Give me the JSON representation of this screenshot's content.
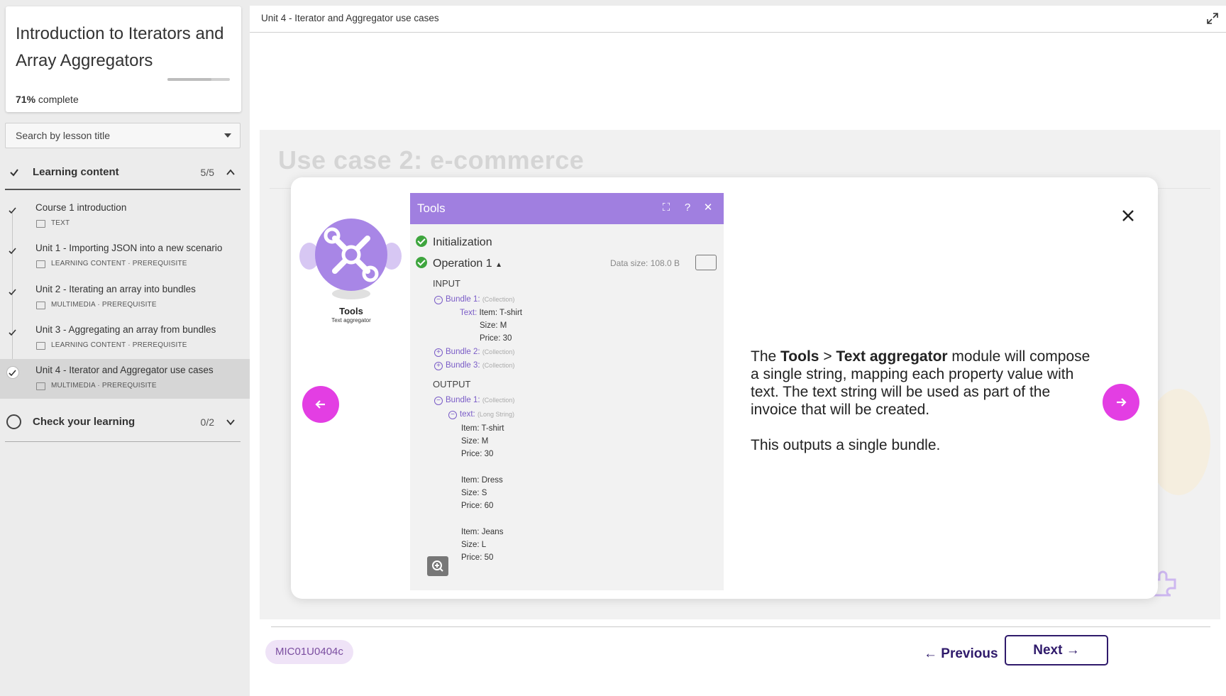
{
  "course": {
    "title": "Introduction to Iterators and Array Aggregators",
    "progress_percent": 71,
    "progress_value": "71%",
    "progress_suffix": "complete"
  },
  "search": {
    "placeholder": "Search by lesson title"
  },
  "sections": [
    {
      "title": "Learning content",
      "count": "5/5",
      "expanded": true,
      "lessons": [
        {
          "title": "Course 1 introduction",
          "meta": "TEXT",
          "completed": true,
          "active": false
        },
        {
          "title": "Unit 1 - Importing JSON into a new scenario",
          "meta": "LEARNING CONTENT · PREREQUISITE",
          "completed": true,
          "active": false
        },
        {
          "title": "Unit 2 - Iterating an array into bundles",
          "meta": "MULTIMEDIA · PREREQUISITE",
          "completed": true,
          "active": false
        },
        {
          "title": "Unit 3 - Aggregating an array from bundles",
          "meta": "LEARNING CONTENT · PREREQUISITE",
          "completed": true,
          "active": false
        },
        {
          "title": "Unit 4 - Iterator and Aggregator use cases",
          "meta": "MULTIMEDIA · PREREQUISITE",
          "completed": true,
          "active": true
        }
      ]
    },
    {
      "title": "Check your learning",
      "count": "0/2",
      "expanded": false
    }
  ],
  "main": {
    "breadcrumb": "Unit 4 - Iterator and Aggregator use cases",
    "slide_title": "Use case 2: e-commerce"
  },
  "modal": {
    "module_name": "Tools",
    "module_sub": "Text aggregator",
    "panel": {
      "title": "Tools",
      "init": "Initialization",
      "operation": "Operation 1",
      "data_size": "Data size: 108.0 B",
      "input_label": "INPUT",
      "output_label": "OUTPUT",
      "bundle1": "Bundle 1:",
      "bundle2": "Bundle 2:",
      "bundle3": "Bundle 3:",
      "collection": "(Collection)",
      "text_key": "Text:",
      "text_item": "Item: T-shirt",
      "text_size": "Size: M",
      "text_price": "Price: 30",
      "out_text_key": "text:",
      "long_string": "(Long String)",
      "out_lines": [
        "Item: T-shirt",
        "Size: M",
        "Price: 30",
        "",
        "Item: Dress",
        "Size: S",
        "Price: 60",
        "",
        "Item: Jeans",
        "Size: L",
        "Price: 50"
      ]
    },
    "text_pre": "The ",
    "text_bold1": "Tools",
    "text_mid": " > ",
    "text_bold2": "Text aggregator",
    "text_post": " module will compose a single string, mapping each property value with text. The text string will be used as part of the invoice that will be created.",
    "text_second": "This outputs a single bundle."
  },
  "footer": {
    "code": "MIC01U0404c",
    "previous_label": "Previous",
    "next_label": "Next"
  },
  "colors": {
    "accent": "#e33ee3",
    "brand_dark": "#2f1a6b",
    "module_purple": "#a886e6"
  }
}
